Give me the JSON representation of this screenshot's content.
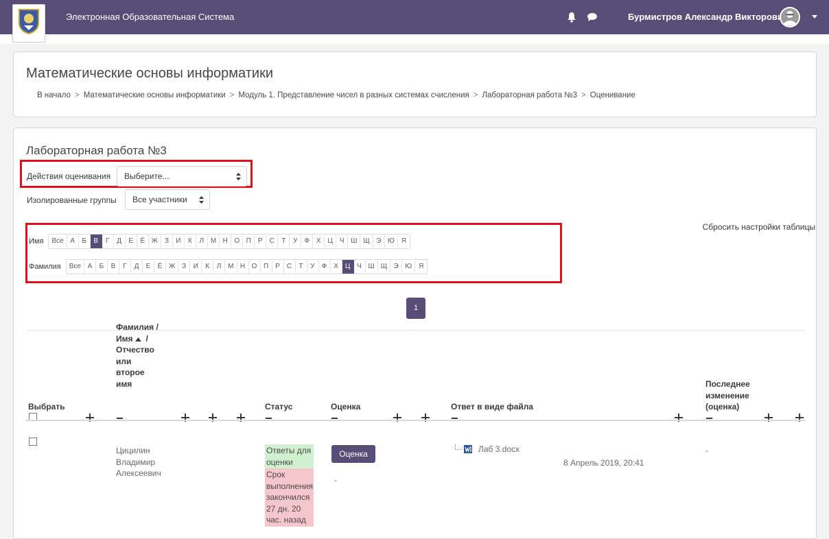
{
  "navbar": {
    "site_name": "Электронная Образовательная Система",
    "user_name": "Бурмистров Александр Викторович",
    "icons": [
      "bell-icon",
      "chat-icon",
      "avatar-icon",
      "caret-down-icon"
    ]
  },
  "header": {
    "title": "Математические основы информатики",
    "breadcrumb": [
      "В начало",
      "Математические основы информатики",
      "Модуль 1. Представление чисел в разных системах счисления",
      "Лабораторная работа №3",
      "Оценивание"
    ],
    "separator": ">"
  },
  "assignment": {
    "title": "Лабораторная работа №3",
    "grading_action_label": "Действия оценивания",
    "grading_action_value": "Выберите...",
    "groups_label": "Изолированные группы",
    "groups_value": "Все участники",
    "reset_label": "Сбросить настройки таблицы"
  },
  "initials": {
    "first_label": "Имя",
    "last_label": "Фамилия",
    "letters": [
      "Все",
      "А",
      "Б",
      "В",
      "Г",
      "Д",
      "Е",
      "Ё",
      "Ж",
      "З",
      "И",
      "К",
      "Л",
      "М",
      "Н",
      "О",
      "П",
      "Р",
      "С",
      "Т",
      "У",
      "Ф",
      "Х",
      "Ц",
      "Ч",
      "Ш",
      "Щ",
      "Э",
      "Ю",
      "Я"
    ],
    "first_active": "В",
    "last_active": "Ц"
  },
  "pagination": {
    "current": "1"
  },
  "table": {
    "headers": {
      "select": "Выбрать",
      "name_l1": "Фамилия /",
      "name_l2": "Имя",
      "name_l2b": "/",
      "name_l3": "Отчество",
      "name_l4": "или",
      "name_l5": "второе",
      "name_l6": "имя",
      "status": "Статус",
      "grade": "Оценка",
      "file": "Ответ в виде файла",
      "modified_l1": "Последнее",
      "modified_l2": "изменение",
      "modified_l3": "(оценка)"
    },
    "rows": [
      {
        "name_l1": "Цицилин",
        "name_l2": "Владимир",
        "name_l3": "Алексеевич",
        "status_ok_l1": "Ответы для",
        "status_ok_l2": "оценки",
        "status_late_l1": "Срок",
        "status_late_l2": "выполнения",
        "status_late_l3": "закончился",
        "status_late_l4": "27 дн. 20",
        "status_late_l5": "час. назад",
        "grade_button": "Оценка",
        "grade_value": "-",
        "file_name": "Лаб 3.docx",
        "file_date": "8 Апрель 2019, 20:41",
        "modified": "-"
      }
    ]
  },
  "colors": {
    "brand": "#584d77",
    "highlight": "#e3101a",
    "status_ok": "#d1f0d0",
    "status_late": "#f5c6cb"
  }
}
